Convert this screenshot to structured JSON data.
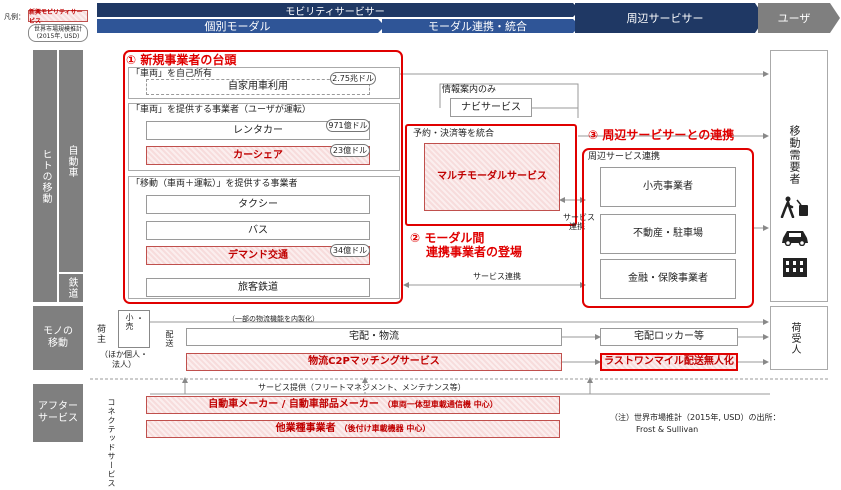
{
  "legend": {
    "label": "凡例：",
    "sample": "新興モビリティサービス",
    "unit_line1": "世界市場規模推計",
    "unit_line2": "(2015年, USD)"
  },
  "header": {
    "mobility_service": "モビリティサービサー",
    "individual_modal": "個別モーダル",
    "modal_integration": "モーダル連携・統合",
    "peripheral_servicer": "周辺サービサー",
    "user": "ユーザ"
  },
  "rows": {
    "people_movement": "ヒトの移動",
    "automobile": "自動車",
    "railway": "鉄道",
    "goods_movement_l1": "モノの",
    "goods_movement_l2": "移動",
    "after_services_l1": "アフター",
    "after_services_l2": "サービス"
  },
  "section1": {
    "title": "① 新規事業者の台頭",
    "own_vehicle_label": "「車両」を自己所有",
    "own_car_use": "自家用車利用",
    "own_car_market": "2.75兆ドル",
    "provide_vehicle_label": "「車両」を提供する事業者（ユーザが運転）",
    "rental_car": "レンタカー",
    "rental_car_market": "971億ドル",
    "car_share": "カーシェア",
    "car_share_market": "23億ドル",
    "provide_move_label": "「移動（車両＋運転）」を提供する事業者",
    "taxi": "タクシー",
    "bus": "バス",
    "demand_transport": "デマンド交通",
    "demand_market": "34億ドル",
    "passenger_rail": "旅客鉄道"
  },
  "info": {
    "label": "情報案内のみ",
    "navi": "ナビサービス"
  },
  "integration": {
    "label": "予約・決済等を統合",
    "multimodal": "マルチモーダルサービス"
  },
  "section2": {
    "title_l1": "② モーダル間",
    "title_l2": "連携事業者の登場"
  },
  "section3": {
    "title": "③ 周辺サービサーとの連携",
    "label": "周辺サービス連携",
    "retail": "小売事業者",
    "real_estate": "不動産・駐車場",
    "finance": "金融・保険事業者"
  },
  "service_link": "サービス連携",
  "service_link_vertical_l1": "サービス",
  "service_link_vertical_l2": "連携",
  "mobility_demand": "移動需要者",
  "goods": {
    "shipper": "荷主",
    "retail_small": "小売",
    "retail_suffix": "・",
    "others": "（ほか個人・法人）",
    "delivery": "配送",
    "some_logistics": "（一部の物流機能を内製化）",
    "parcel": "宅配・物流",
    "c2p": "物流C2Pマッチングサービス",
    "locker": "宅配ロッカー等",
    "last_mile": "ラストワンマイル配送無人化",
    "recipient": "荷受人"
  },
  "after": {
    "service_provision": "サービス提供（フリートマネジメント、メンテナンス等）",
    "connected": "コネクテッドサービス",
    "maker": "自動車メーカー / 自動車部品メーカー",
    "maker_note": "（車両一体型車載通信機 中心）",
    "other": "他業種事業者",
    "other_note": "（後付け車載機器 中心）"
  },
  "note": {
    "line1": "（注）世界市場推計（2015年, USD）の出所：",
    "line2": "Frost & Sullivan"
  },
  "colors": {
    "header_navy": "#1f3864",
    "header_blue": "#2f5597",
    "grey_label": "#7f7f7f",
    "accent_red": "#e00000",
    "pink_fill": "#f7dcdc"
  },
  "icons": [
    "walking-with-luggage-icon",
    "car-icon",
    "building-icon"
  ]
}
